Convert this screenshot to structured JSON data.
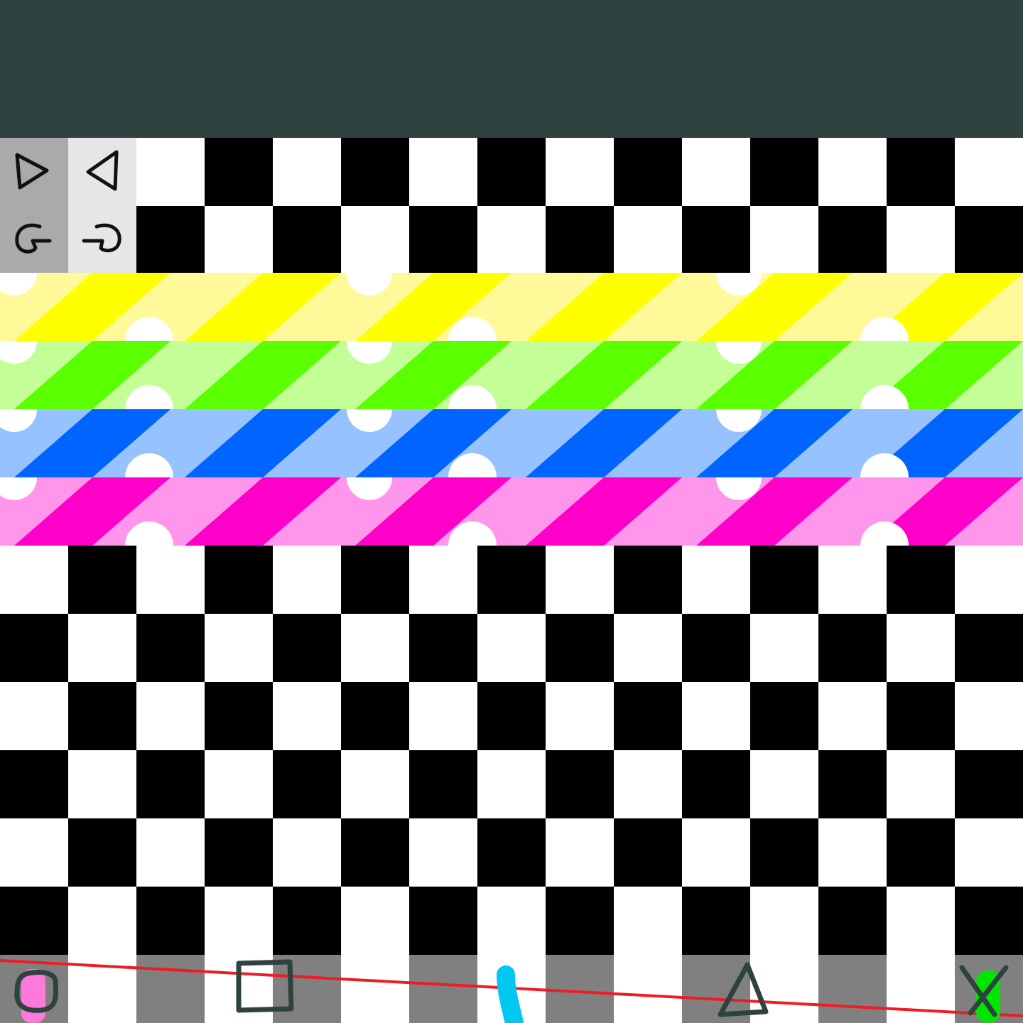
{
  "app": {
    "palette": {
      "top_bar": "#2e4340",
      "checker_dark": "#000000",
      "checker_light": "#ffffff",
      "tray_dark": "#808080",
      "guide_line": "#ee1c24"
    }
  },
  "toolbar": {
    "buttons": [
      {
        "icon": "play-right-icon"
      },
      {
        "icon": "play-left-icon"
      },
      {
        "icon": "rotate-right-icon"
      },
      {
        "icon": "rotate-left-icon"
      }
    ]
  },
  "stripe_bands": [
    {
      "name": "yellow",
      "light": "#fff99a",
      "dark": "#ffff00"
    },
    {
      "name": "green",
      "light": "#c3ff96",
      "dark": "#5aff00"
    },
    {
      "name": "blue",
      "light": "#96c3ff",
      "dark": "#0064ff"
    },
    {
      "name": "pink",
      "light": "#ff96eb",
      "dark": "#ff00c8"
    }
  ],
  "pieces_tray": {
    "items": [
      {
        "icon": "circle-piece-icon",
        "accent": "#ff78dc"
      },
      {
        "icon": "square-piece-icon"
      },
      {
        "icon": "line-piece-icon",
        "accent": "#00c8f0"
      },
      {
        "icon": "triangle-piece-icon"
      },
      {
        "icon": "cross-piece-icon",
        "accent": "#00e600"
      }
    ]
  }
}
